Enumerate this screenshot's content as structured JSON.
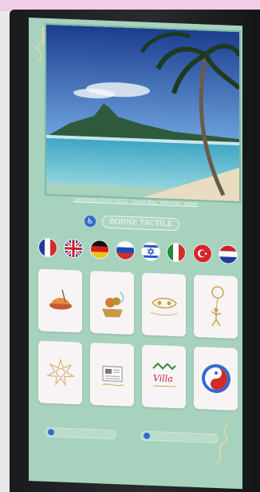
{
  "screen": {
    "caption": "Upcoming 2010 / 2011 : Sinay Bay, Valmorel, Vaboli",
    "borne_label": "BORNE TACTILE",
    "accessibility_icon": "wheelchair-icon"
  },
  "flags": [
    {
      "name": "flag-france",
      "country": "France"
    },
    {
      "name": "flag-uk",
      "country": "United Kingdom"
    },
    {
      "name": "flag-germany",
      "country": "Germany"
    },
    {
      "name": "flag-russia",
      "country": "Russia"
    },
    {
      "name": "flag-israel",
      "country": "Israel"
    },
    {
      "name": "flag-italy",
      "country": "Italy"
    },
    {
      "name": "flag-turkey",
      "country": "Turkey"
    },
    {
      "name": "flag-netherlands",
      "country": "Netherlands"
    }
  ],
  "tiles": [
    {
      "name": "tile-food-icon"
    },
    {
      "name": "tile-gift-basket-icon"
    },
    {
      "name": "tile-carnival-mask-icon"
    },
    {
      "name": "tile-kids-balloon-icon"
    },
    {
      "name": "tile-spa-flower-icon"
    },
    {
      "name": "tile-newspaper-icon"
    },
    {
      "name": "tile-village-logo-icon"
    },
    {
      "name": "tile-yin-yang-logo-icon"
    }
  ],
  "tile_village_text": "Villa"
}
